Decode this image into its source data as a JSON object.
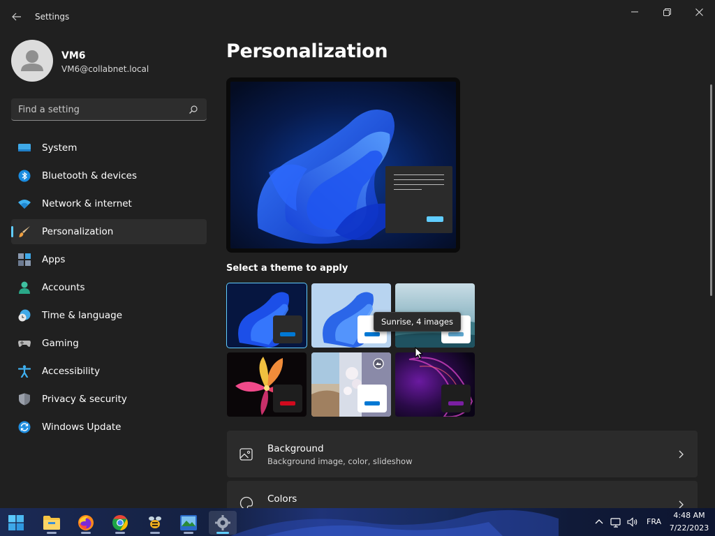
{
  "window": {
    "title": "Settings",
    "controls": {
      "minimize": "minimize-icon",
      "restore": "restore-icon",
      "close": "close-icon"
    }
  },
  "profile": {
    "name": "VM6",
    "email": "VM6@collabnet.local"
  },
  "search": {
    "placeholder": "Find a setting"
  },
  "sidebar": {
    "items": [
      {
        "label": "System",
        "icon": "monitor-icon",
        "selected": false
      },
      {
        "label": "Bluetooth & devices",
        "icon": "bluetooth-icon",
        "selected": false
      },
      {
        "label": "Network & internet",
        "icon": "wifi-icon",
        "selected": false
      },
      {
        "label": "Personalization",
        "icon": "paintbrush-icon",
        "selected": true
      },
      {
        "label": "Apps",
        "icon": "apps-icon",
        "selected": false
      },
      {
        "label": "Accounts",
        "icon": "person-icon",
        "selected": false
      },
      {
        "label": "Time & language",
        "icon": "clock-globe-icon",
        "selected": false
      },
      {
        "label": "Gaming",
        "icon": "gamepad-icon",
        "selected": false
      },
      {
        "label": "Accessibility",
        "icon": "accessibility-icon",
        "selected": false
      },
      {
        "label": "Privacy & security",
        "icon": "shield-icon",
        "selected": false
      },
      {
        "label": "Windows Update",
        "icon": "update-icon",
        "selected": false
      }
    ]
  },
  "main": {
    "title": "Personalization",
    "themes_label": "Select a theme to apply",
    "tooltip": "Sunrise, 4 images",
    "themes": [
      {
        "name": "windows-dark",
        "selected": true,
        "accent": "#0078d4"
      },
      {
        "name": "windows-light",
        "selected": false,
        "accent": "#0078d4"
      },
      {
        "name": "sunrise",
        "selected": false,
        "accent": "#60a8d0"
      },
      {
        "name": "flower",
        "selected": false,
        "accent": "#d10a1e"
      },
      {
        "name": "glow",
        "selected": false,
        "accent": "#0078d4"
      },
      {
        "name": "captured-motion",
        "selected": false,
        "accent": "#7a1fa2"
      }
    ],
    "cards": [
      {
        "title": "Background",
        "subtitle": "Background image, color, slideshow",
        "icon": "image-icon"
      },
      {
        "title": "Colors",
        "subtitle": "",
        "icon": "palette-icon"
      }
    ]
  },
  "taskbar": {
    "apps": [
      {
        "name": "start",
        "icon": "windows-start-icon"
      },
      {
        "name": "file-explorer",
        "icon": "folder-icon"
      },
      {
        "name": "firefox",
        "icon": "firefox-icon"
      },
      {
        "name": "chrome",
        "icon": "chrome-icon"
      },
      {
        "name": "app-bee",
        "icon": "bee-app-icon"
      },
      {
        "name": "app-photo",
        "icon": "photo-app-icon"
      },
      {
        "name": "settings",
        "icon": "settings-gear-icon"
      }
    ],
    "language": "FRA",
    "time": "4:48 AM",
    "date": "7/22/2023"
  },
  "colors": {
    "accent": "#60cdff",
    "background": "#202020",
    "card": "#2b2b2b"
  }
}
